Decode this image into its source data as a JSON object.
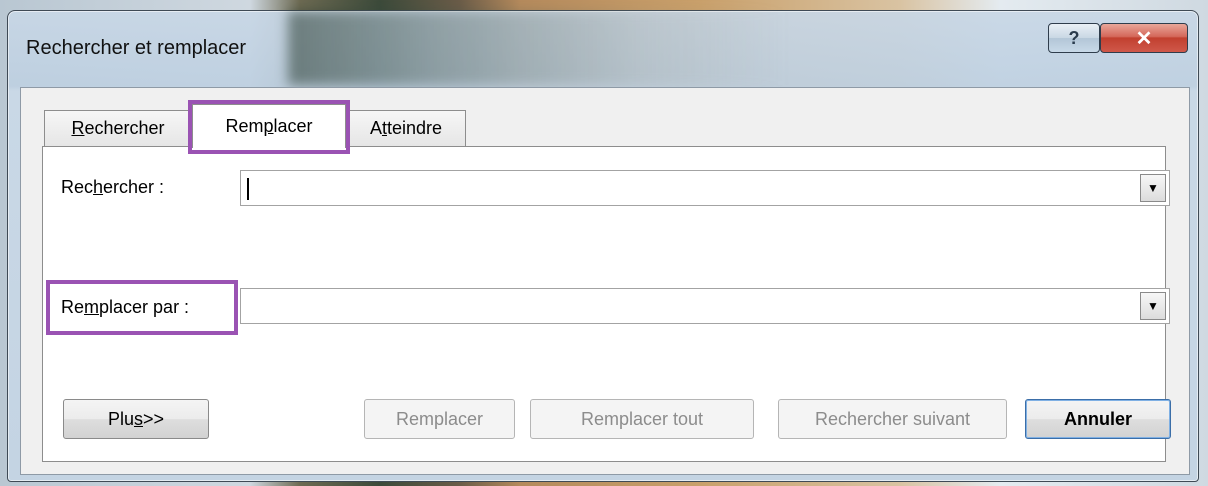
{
  "window": {
    "title": "Rechercher et remplacer",
    "help_glyph": "?",
    "close_glyph": "✕"
  },
  "tabs": [
    {
      "pre": "",
      "u": "R",
      "post": "echercher"
    },
    {
      "pre": "Rem",
      "u": "p",
      "post": "lacer"
    },
    {
      "pre": "A",
      "u": "t",
      "post": "teindre"
    }
  ],
  "find": {
    "label_pre": "Rec",
    "label_u": "h",
    "label_post": "ercher :",
    "value": ""
  },
  "replace": {
    "label_pre": "Re",
    "label_u": "m",
    "label_post": "placer par :",
    "value": ""
  },
  "buttons": {
    "more_pre": "Plu",
    "more_u": "s",
    "more_post": " >>",
    "replace": "Remplacer",
    "replace_all": "Remplacer tout",
    "find_next": "Rechercher suivant",
    "cancel": "Annuler"
  },
  "dropdown_glyph": "▼",
  "colors": {
    "highlight": "#9a53b3",
    "disabled_text": "#8c8c8c",
    "close_red": "#c1402f"
  }
}
